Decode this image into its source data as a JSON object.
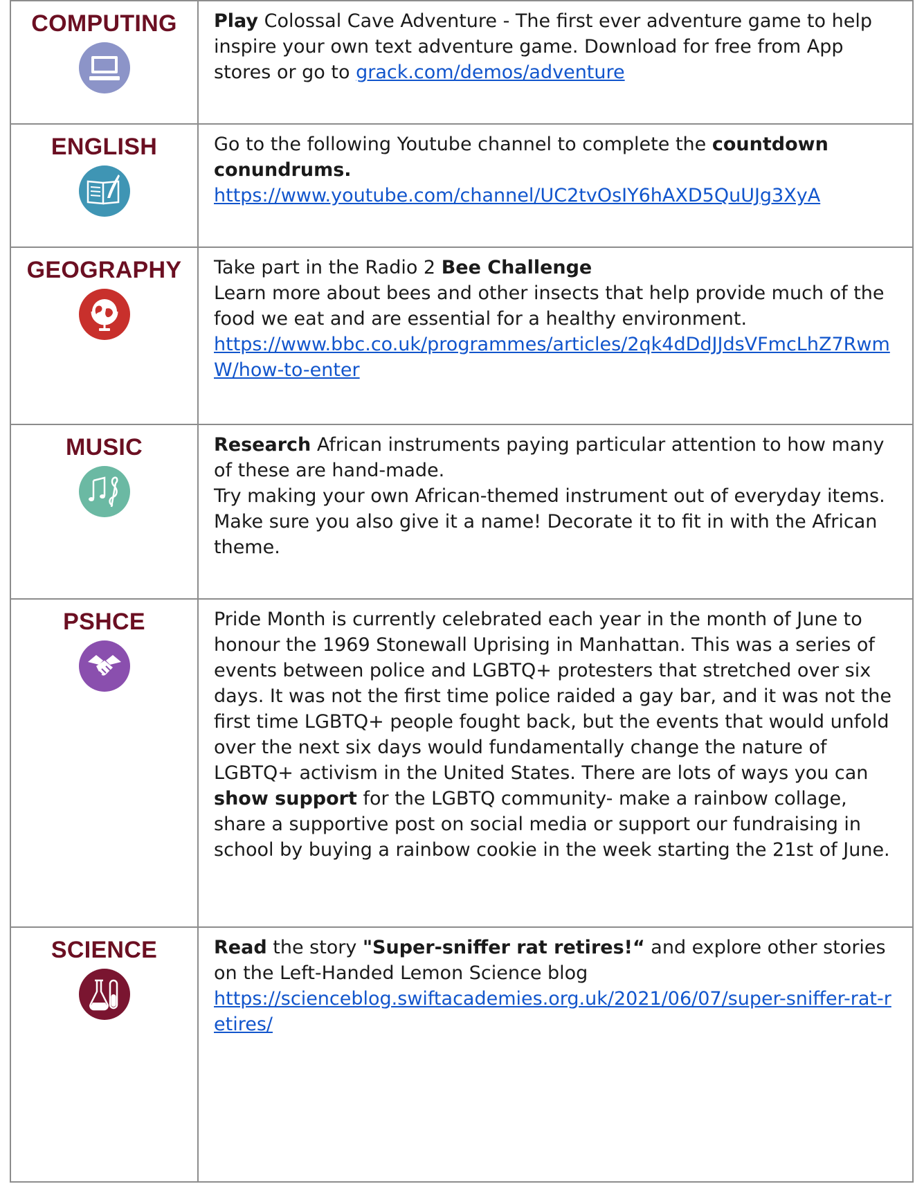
{
  "rows": [
    {
      "subject": "COMPUTING",
      "icon": "computer-icon",
      "color": "#8c94c8",
      "segments": [
        {
          "bold": "Play"
        },
        {
          "text": " Colossal Cave Adventure - The first ever adventure game to help inspire your own text adventure game. Download for free from App stores or go to "
        },
        {
          "link": "grack.com/demos/adventure"
        }
      ]
    },
    {
      "subject": "ENGLISH",
      "icon": "book-quill-icon",
      "color": "#3f95b4",
      "segments": [
        {
          "text": "Go to the following Youtube channel to complete the "
        },
        {
          "bold": "countdown conundrums."
        },
        {
          "br": true
        },
        {
          "text": " "
        },
        {
          "link": "https://www.youtube.com/channel/UC2tvOsIY6hAXD5QuUJg3XyA"
        }
      ]
    },
    {
      "subject": "GEOGRAPHY",
      "icon": "globe-icon",
      "color": "#c8302c",
      "segments": [
        {
          "text": "Take part in the Radio 2 "
        },
        {
          "bold": "Bee Challenge"
        },
        {
          "br": true
        },
        {
          "text": "Learn more about bees and other insects that help provide much of the food we eat and are essential for a healthy environment."
        },
        {
          "br": true
        },
        {
          "link": "https://www.bbc.co.uk/programmes/articles/2qk4dDdJJdsVFmcLhZ7RwmW/how-to-enter"
        }
      ]
    },
    {
      "subject": "MUSIC",
      "icon": "music-notes-icon",
      "color": "#6bb9a3",
      "segments": [
        {
          "bold": "Research"
        },
        {
          "text": " African instruments paying particular attention to how many of these are hand-made."
        },
        {
          "br": true
        },
        {
          "text": "Try making your own African-themed instrument out of everyday items. Make sure you also give it a name! Decorate it to fit in with the African theme."
        }
      ]
    },
    {
      "subject": "PSHCE",
      "icon": "handshake-icon",
      "color": "#8a4fae",
      "segments": [
        {
          "text": "Pride Month is currently celebrated each year in the month of June to honour the 1969 Stonewall Uprising in Manhattan. This was a series of events between police and LGBTQ+ protesters that stretched over six days. It was not the first time police raided a gay bar, and it was not the first time LGBTQ+ people fought back, but the events that would unfold over the next six days would fundamentally change the nature of LGBTQ+ activism in the United States.  There are lots of ways you can "
        },
        {
          "bold": "show support"
        },
        {
          "text": " for the LGBTQ community- make a rainbow collage, share a supportive post on social media or support our fundraising in school by buying a rainbow cookie in the week starting the 21st of June."
        }
      ]
    },
    {
      "subject": "SCIENCE",
      "icon": "flask-tube-icon",
      "color": "#7a1530",
      "segments": [
        {
          "bold": "Read"
        },
        {
          "text": " the story "
        },
        {
          "bold": "\"Super-sniffer rat retires!“"
        },
        {
          "text": " and explore other stories on the Left-Handed Lemon Science blog"
        },
        {
          "br": true
        },
        {
          "link": "https://scienceblog.swiftacademies.org.uk/2021/06/07/super-sniffer-rat-retires/"
        }
      ]
    }
  ]
}
